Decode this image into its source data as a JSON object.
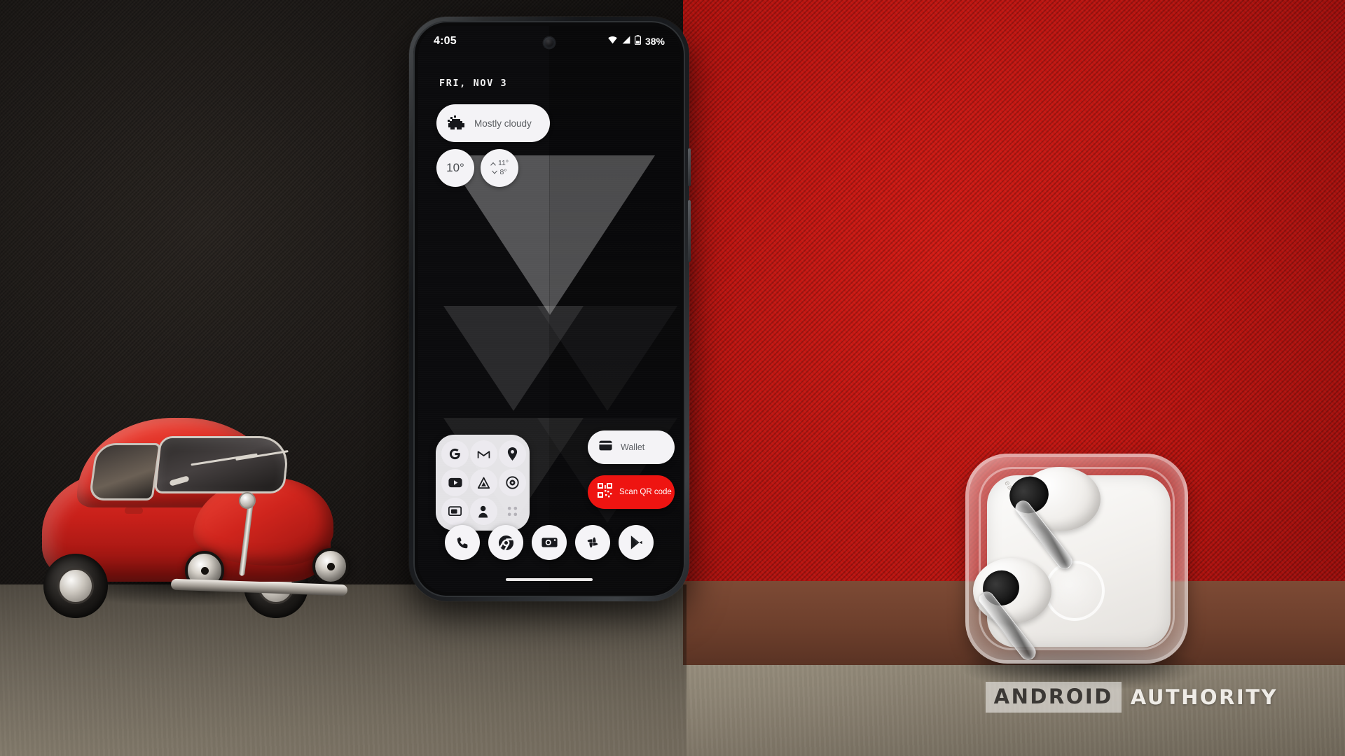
{
  "scene": {
    "description": "Product photo of an Android smartphone home screen standing on a desk between a red toy VW Beetle and transparent earbuds case",
    "background_left_color": "#1a1715",
    "background_right_color": "#b8130f",
    "desk_color": "#a79e8d"
  },
  "phone": {
    "status_bar": {
      "time": "4:05",
      "wifi_icon": "wifi-icon",
      "signal_icon": "cellular-signal-icon",
      "battery_icon": "battery-icon",
      "battery_percent": "38%"
    },
    "date": "FRI, NOV 3",
    "weather": {
      "condition": "Mostly cloudy",
      "condition_icon": "cloud-icon",
      "current_temp": "10°",
      "high_temp": "11°",
      "low_temp": "8°",
      "high_arrow": "chevron-up-icon",
      "low_arrow": "chevron-down-icon"
    },
    "apps_widget": {
      "name": "google-apps-grid",
      "apps": [
        {
          "label": "Google",
          "icon": "google-g-icon"
        },
        {
          "label": "Gmail",
          "icon": "gmail-icon"
        },
        {
          "label": "Maps",
          "icon": "maps-pin-icon"
        },
        {
          "label": "YouTube",
          "icon": "youtube-icon"
        },
        {
          "label": "Drive",
          "icon": "drive-icon"
        },
        {
          "label": "Photos",
          "icon": "disc-icon"
        },
        {
          "label": "Cast",
          "icon": "cast-screen-icon"
        },
        {
          "label": "Contacts",
          "icon": "person-icon"
        },
        {
          "label": "More",
          "icon": "four-dots-icon"
        }
      ]
    },
    "wallet_button": {
      "label": "Wallet",
      "icon": "credit-card-icon",
      "background": "#f4f3f6"
    },
    "qr_button": {
      "label": "Scan QR code",
      "icon": "qr-code-icon",
      "background": "#ee1411",
      "text_color": "#ffffff"
    },
    "dock": [
      {
        "label": "Phone",
        "icon": "phone-handset-icon"
      },
      {
        "label": "Chrome",
        "icon": "chrome-icon"
      },
      {
        "label": "Camera",
        "icon": "camera-icon"
      },
      {
        "label": "Photos",
        "icon": "pinwheel-icon"
      },
      {
        "label": "Play Store",
        "icon": "play-store-icon"
      }
    ],
    "gesture_bar": "home-gesture-bar",
    "wallpaper": "dark-chevron-triangles"
  },
  "objects": {
    "toy_car": "red-toy-volkswagen-beetle",
    "earbuds": "white-earbuds-in-transparent-case",
    "earbuds_label": "ear (case)"
  },
  "watermark": {
    "word1": "ANDROID",
    "word2": "AUTHORITY"
  }
}
